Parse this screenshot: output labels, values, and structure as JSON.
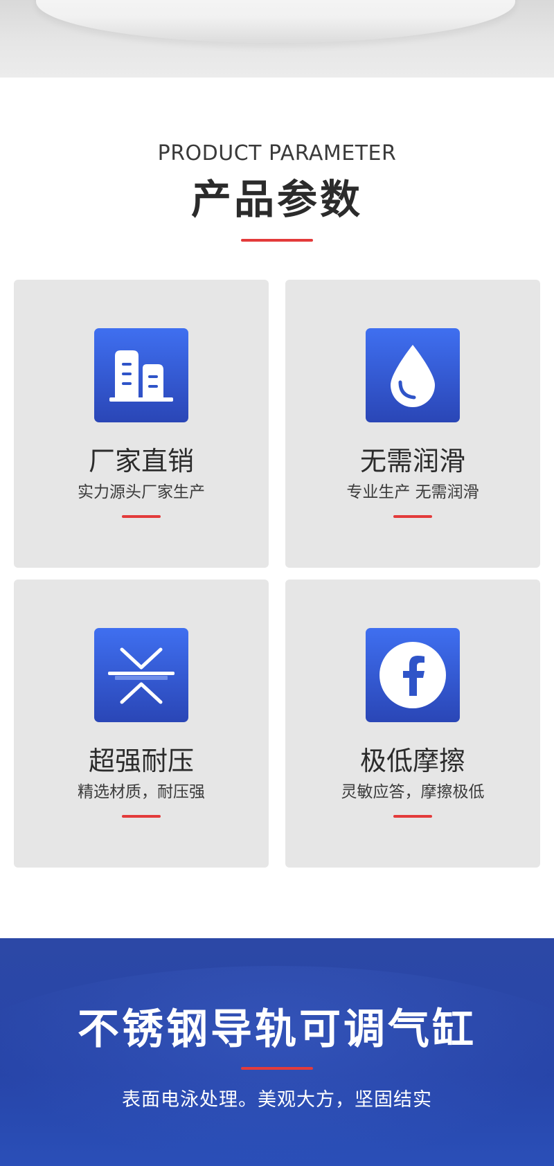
{
  "header": {
    "en_title": "PRODUCT PARAMETER",
    "cn_title": "产品参数"
  },
  "features": [
    {
      "icon": "factory-buildings-icon",
      "title": "厂家直销",
      "subtitle": "实力源头厂家生产"
    },
    {
      "icon": "water-drop-icon",
      "title": "无需润滑",
      "subtitle": "专业生产 无需润滑"
    },
    {
      "icon": "compression-arrows-icon",
      "title": "超强耐压",
      "subtitle": "精选材质，耐压强"
    },
    {
      "icon": "facebook-circle-icon",
      "title": "极低摩擦",
      "subtitle": "灵敏应答，摩擦极低"
    }
  ],
  "banner": {
    "title": "不锈钢导轨可调气缸",
    "description": "表面电泳处理。美观大方，坚固结实"
  },
  "colors": {
    "accent_red": "#e33b3b",
    "icon_blue_top": "#3f6ff0",
    "icon_blue_bottom": "#2a46b6",
    "banner_blue": "#2a47aa",
    "card_gray": "#e6e6e6"
  }
}
